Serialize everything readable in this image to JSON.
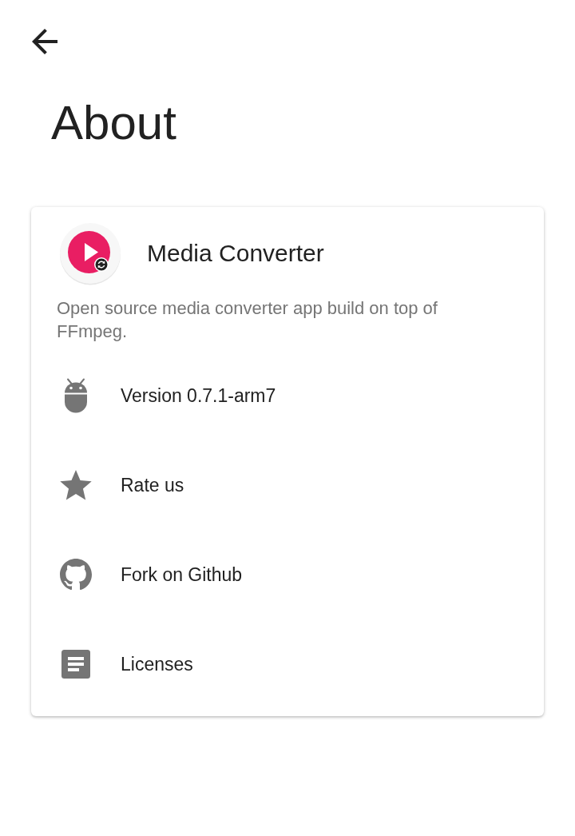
{
  "toolbar": {
    "title": "About"
  },
  "app": {
    "name": "Media Converter",
    "description": "Open source media converter app build on top of FFmpeg."
  },
  "items": [
    {
      "label": "Version 0.7.1-arm7"
    },
    {
      "label": "Rate us"
    },
    {
      "label": "Fork on Github"
    },
    {
      "label": "Licenses"
    }
  ]
}
